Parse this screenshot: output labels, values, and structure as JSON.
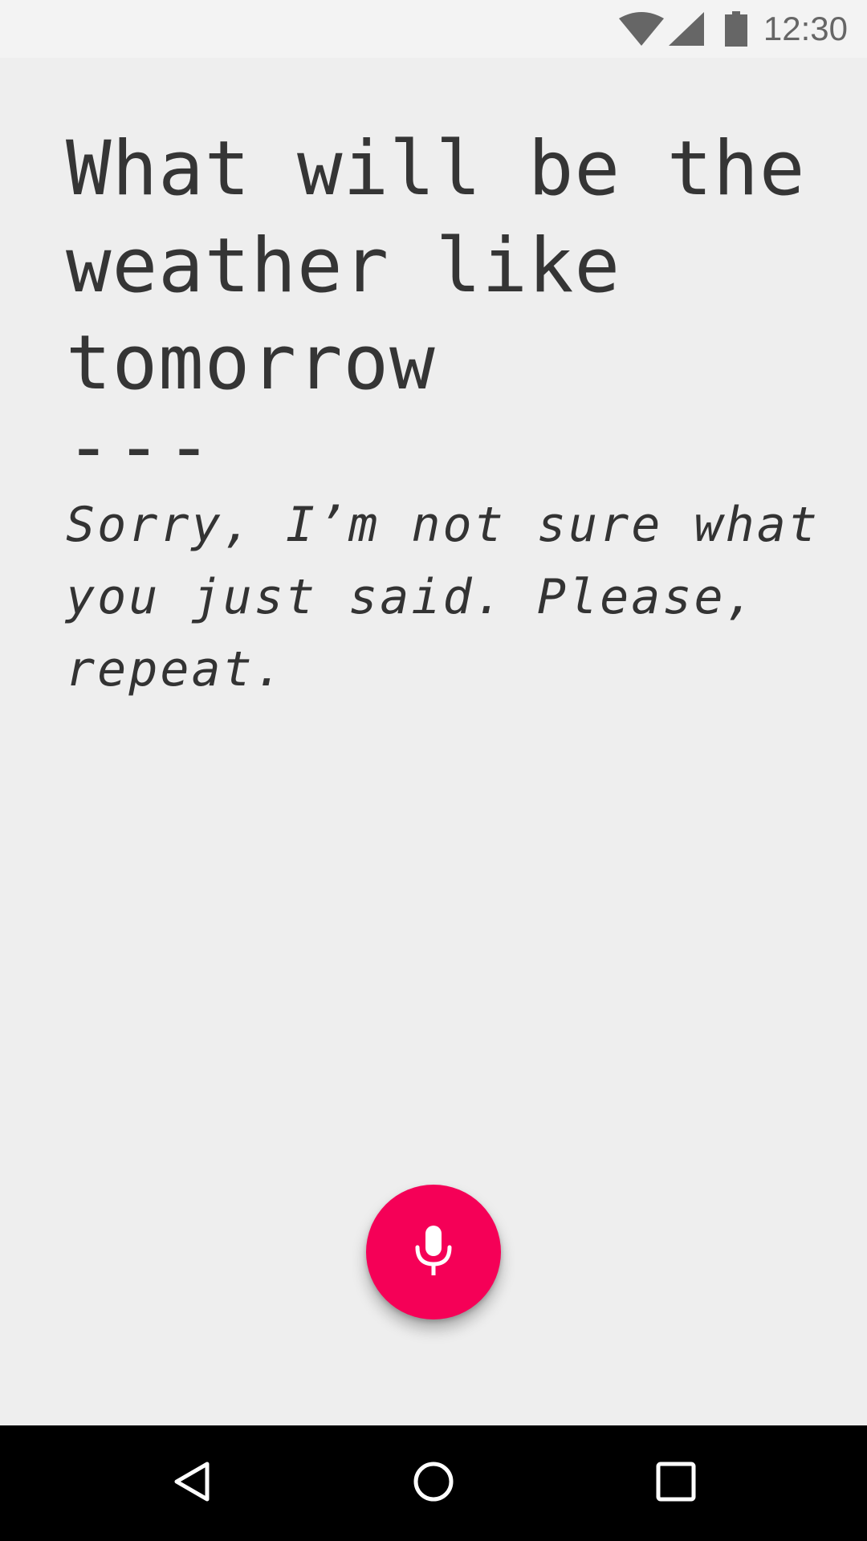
{
  "status_bar": {
    "time": "12:30",
    "icons": [
      "wifi-icon",
      "cell-signal-icon",
      "battery-icon"
    ]
  },
  "conversation": {
    "query": "What will be the weather like tomorrow",
    "separator": "---",
    "response": "Sorry, I’m not sure what you just said. Please, repeat."
  },
  "mic_button": {
    "icon": "microphone-icon",
    "color": "#f50057"
  },
  "nav_bar": {
    "buttons": [
      "back-icon",
      "home-icon",
      "recents-icon"
    ]
  }
}
